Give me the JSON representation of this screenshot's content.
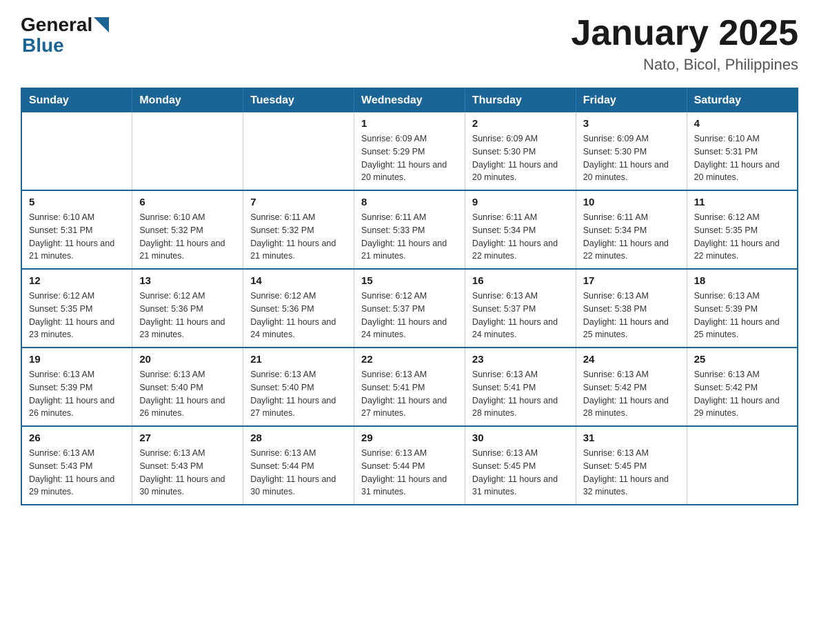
{
  "header": {
    "logo_general": "General",
    "logo_blue": "Blue",
    "month_title": "January 2025",
    "location": "Nato, Bicol, Philippines"
  },
  "weekdays": [
    "Sunday",
    "Monday",
    "Tuesday",
    "Wednesday",
    "Thursday",
    "Friday",
    "Saturday"
  ],
  "weeks": [
    [
      {
        "day": "",
        "info": ""
      },
      {
        "day": "",
        "info": ""
      },
      {
        "day": "",
        "info": ""
      },
      {
        "day": "1",
        "info": "Sunrise: 6:09 AM\nSunset: 5:29 PM\nDaylight: 11 hours and 20 minutes."
      },
      {
        "day": "2",
        "info": "Sunrise: 6:09 AM\nSunset: 5:30 PM\nDaylight: 11 hours and 20 minutes."
      },
      {
        "day": "3",
        "info": "Sunrise: 6:09 AM\nSunset: 5:30 PM\nDaylight: 11 hours and 20 minutes."
      },
      {
        "day": "4",
        "info": "Sunrise: 6:10 AM\nSunset: 5:31 PM\nDaylight: 11 hours and 20 minutes."
      }
    ],
    [
      {
        "day": "5",
        "info": "Sunrise: 6:10 AM\nSunset: 5:31 PM\nDaylight: 11 hours and 21 minutes."
      },
      {
        "day": "6",
        "info": "Sunrise: 6:10 AM\nSunset: 5:32 PM\nDaylight: 11 hours and 21 minutes."
      },
      {
        "day": "7",
        "info": "Sunrise: 6:11 AM\nSunset: 5:32 PM\nDaylight: 11 hours and 21 minutes."
      },
      {
        "day": "8",
        "info": "Sunrise: 6:11 AM\nSunset: 5:33 PM\nDaylight: 11 hours and 21 minutes."
      },
      {
        "day": "9",
        "info": "Sunrise: 6:11 AM\nSunset: 5:34 PM\nDaylight: 11 hours and 22 minutes."
      },
      {
        "day": "10",
        "info": "Sunrise: 6:11 AM\nSunset: 5:34 PM\nDaylight: 11 hours and 22 minutes."
      },
      {
        "day": "11",
        "info": "Sunrise: 6:12 AM\nSunset: 5:35 PM\nDaylight: 11 hours and 22 minutes."
      }
    ],
    [
      {
        "day": "12",
        "info": "Sunrise: 6:12 AM\nSunset: 5:35 PM\nDaylight: 11 hours and 23 minutes."
      },
      {
        "day": "13",
        "info": "Sunrise: 6:12 AM\nSunset: 5:36 PM\nDaylight: 11 hours and 23 minutes."
      },
      {
        "day": "14",
        "info": "Sunrise: 6:12 AM\nSunset: 5:36 PM\nDaylight: 11 hours and 24 minutes."
      },
      {
        "day": "15",
        "info": "Sunrise: 6:12 AM\nSunset: 5:37 PM\nDaylight: 11 hours and 24 minutes."
      },
      {
        "day": "16",
        "info": "Sunrise: 6:13 AM\nSunset: 5:37 PM\nDaylight: 11 hours and 24 minutes."
      },
      {
        "day": "17",
        "info": "Sunrise: 6:13 AM\nSunset: 5:38 PM\nDaylight: 11 hours and 25 minutes."
      },
      {
        "day": "18",
        "info": "Sunrise: 6:13 AM\nSunset: 5:39 PM\nDaylight: 11 hours and 25 minutes."
      }
    ],
    [
      {
        "day": "19",
        "info": "Sunrise: 6:13 AM\nSunset: 5:39 PM\nDaylight: 11 hours and 26 minutes."
      },
      {
        "day": "20",
        "info": "Sunrise: 6:13 AM\nSunset: 5:40 PM\nDaylight: 11 hours and 26 minutes."
      },
      {
        "day": "21",
        "info": "Sunrise: 6:13 AM\nSunset: 5:40 PM\nDaylight: 11 hours and 27 minutes."
      },
      {
        "day": "22",
        "info": "Sunrise: 6:13 AM\nSunset: 5:41 PM\nDaylight: 11 hours and 27 minutes."
      },
      {
        "day": "23",
        "info": "Sunrise: 6:13 AM\nSunset: 5:41 PM\nDaylight: 11 hours and 28 minutes."
      },
      {
        "day": "24",
        "info": "Sunrise: 6:13 AM\nSunset: 5:42 PM\nDaylight: 11 hours and 28 minutes."
      },
      {
        "day": "25",
        "info": "Sunrise: 6:13 AM\nSunset: 5:42 PM\nDaylight: 11 hours and 29 minutes."
      }
    ],
    [
      {
        "day": "26",
        "info": "Sunrise: 6:13 AM\nSunset: 5:43 PM\nDaylight: 11 hours and 29 minutes."
      },
      {
        "day": "27",
        "info": "Sunrise: 6:13 AM\nSunset: 5:43 PM\nDaylight: 11 hours and 30 minutes."
      },
      {
        "day": "28",
        "info": "Sunrise: 6:13 AM\nSunset: 5:44 PM\nDaylight: 11 hours and 30 minutes."
      },
      {
        "day": "29",
        "info": "Sunrise: 6:13 AM\nSunset: 5:44 PM\nDaylight: 11 hours and 31 minutes."
      },
      {
        "day": "30",
        "info": "Sunrise: 6:13 AM\nSunset: 5:45 PM\nDaylight: 11 hours and 31 minutes."
      },
      {
        "day": "31",
        "info": "Sunrise: 6:13 AM\nSunset: 5:45 PM\nDaylight: 11 hours and 32 minutes."
      },
      {
        "day": "",
        "info": ""
      }
    ]
  ]
}
